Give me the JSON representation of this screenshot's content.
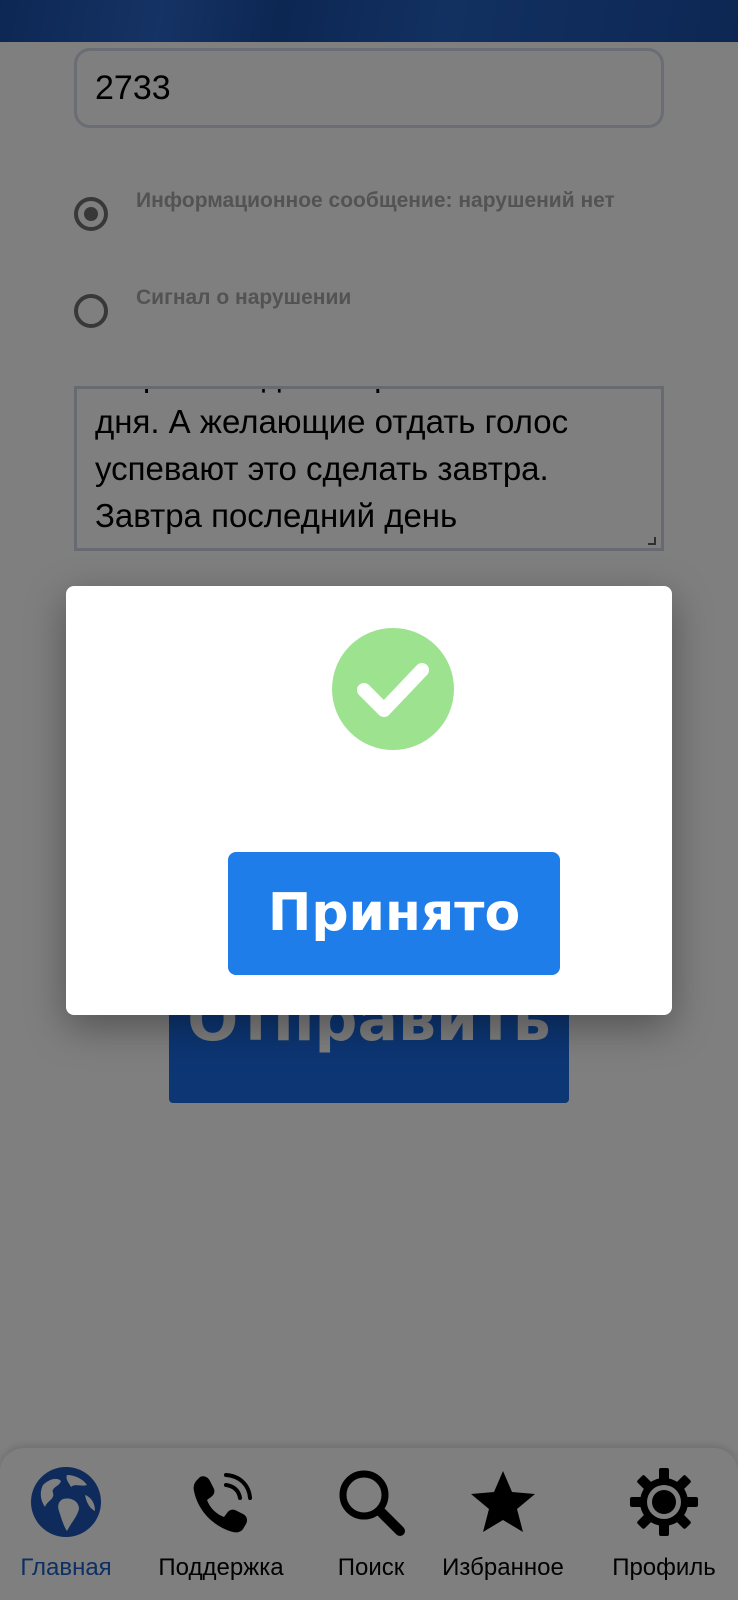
{
  "form": {
    "number_value": "2733",
    "radio_options": [
      {
        "label": "Информационное сообщение: нарушений нет",
        "selected": true
      },
      {
        "label": "Сигнал о нарушении",
        "selected": false
      }
    ],
    "message_text": "закроются до завтрашнего\nдня. А желающие отдать голос\nуспевают это сделать завтра.\nЗавтра последний день",
    "send_label": "Отправить"
  },
  "modal": {
    "status_icon": "check-circle-icon",
    "status_color": "#9de28f",
    "accept_label": "Принято"
  },
  "bottom_nav": {
    "items": [
      {
        "label": "Главная",
        "icon": "globe-icon",
        "active": true
      },
      {
        "label": "Поддержка",
        "icon": "phone-icon",
        "active": false
      },
      {
        "label": "Поиск",
        "icon": "search-icon",
        "active": false
      },
      {
        "label": "Избранное",
        "icon": "star-icon",
        "active": false
      },
      {
        "label": "Профиль",
        "icon": "gear-icon",
        "active": false
      }
    ]
  },
  "colors": {
    "header": "#1b4fa8",
    "primary_button": "#1b6de8",
    "nav_active": "#1b5fc4"
  }
}
